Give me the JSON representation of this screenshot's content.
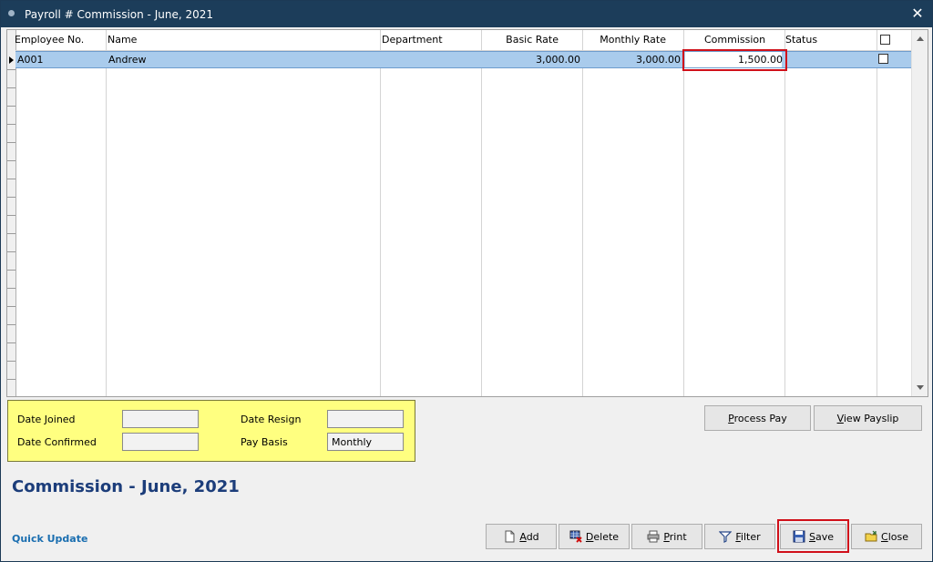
{
  "window": {
    "title": "Payroll # Commission - June, 2021",
    "close_glyph": "✕"
  },
  "grid": {
    "columns": [
      "Employee No.",
      "Name",
      "Department",
      "Basic Rate",
      "Monthly Rate",
      "Commission",
      "Status"
    ],
    "rows": [
      {
        "employee_no": "A001",
        "name": "Andrew",
        "department": "",
        "basic_rate": "3,000.00",
        "monthly_rate": "3,000.00",
        "commission": "1,500.00",
        "status": "",
        "selected": false
      }
    ]
  },
  "info": {
    "date_joined_label": "Date Joined",
    "date_joined_value": "",
    "date_confirmed_label": "Date Confirmed",
    "date_confirmed_value": "",
    "date_resign_label": "Date Resign",
    "date_resign_value": "",
    "pay_basis_label": "Pay Basis",
    "pay_basis_value": "Monthly"
  },
  "actions": {
    "process_pay": {
      "u": "P",
      "rest": "rocess Pay"
    },
    "view_payslip": {
      "u": "V",
      "rest": "iew Payslip"
    }
  },
  "page_title": "Commission - June, 2021",
  "quick_update": "Quick Update",
  "toolbar": {
    "add": {
      "u": "A",
      "rest": "dd",
      "icon": "document-icon"
    },
    "delete": {
      "u": "D",
      "rest": "elete",
      "icon": "delete-grid-icon"
    },
    "print": {
      "u": "P",
      "rest": "rint",
      "icon": "printer-icon"
    },
    "filter": {
      "u": "F",
      "rest": "ilter",
      "icon": "filter-icon"
    },
    "save": {
      "u": "S",
      "rest": "ave",
      "icon": "floppy-disk-icon"
    },
    "close": {
      "u": "C",
      "rest": "lose",
      "icon": "folder-close-icon"
    }
  },
  "colors": {
    "titlebar": "#1c3d5a",
    "selection": "#a9cbec",
    "info_panel": "#ffff80",
    "highlight": "#d0101a",
    "title_text": "#1c3d7a"
  }
}
